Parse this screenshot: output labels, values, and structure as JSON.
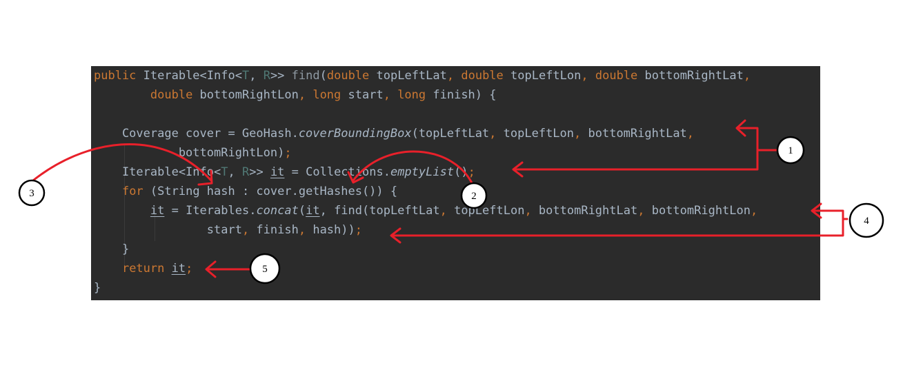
{
  "code": {
    "lines": [
      {
        "segments": [
          {
            "t": "public ",
            "c": "kw"
          },
          {
            "t": "Iterable<Info<"
          },
          {
            "t": "T",
            "c": "tp"
          },
          {
            "t": ", "
          },
          {
            "t": "R",
            "c": "tp"
          },
          {
            "t": ">> "
          },
          {
            "t": "find",
            "c": "dim"
          },
          {
            "t": "("
          },
          {
            "t": "double ",
            "c": "kw"
          },
          {
            "t": "topLeftLat"
          },
          {
            "t": ", ",
            "c": "kw"
          },
          {
            "t": "double ",
            "c": "kw"
          },
          {
            "t": "topLeftLon"
          },
          {
            "t": ", ",
            "c": "kw"
          },
          {
            "t": "double ",
            "c": "kw"
          },
          {
            "t": "bottomRightLat"
          },
          {
            "t": ",",
            "c": "kw"
          }
        ]
      },
      {
        "segments": [
          {
            "t": "        "
          },
          {
            "t": "double ",
            "c": "kw"
          },
          {
            "t": "bottomRightLon"
          },
          {
            "t": ", ",
            "c": "kw"
          },
          {
            "t": "long ",
            "c": "kw"
          },
          {
            "t": "start"
          },
          {
            "t": ", ",
            "c": "kw"
          },
          {
            "t": "long ",
            "c": "kw"
          },
          {
            "t": "finish) {"
          }
        ]
      },
      {
        "segments": [
          {
            "t": ""
          }
        ]
      },
      {
        "segments": [
          {
            "t": "    Coverage cover = GeoHash."
          },
          {
            "t": "coverBoundingBox",
            "c": "it"
          },
          {
            "t": "(topLeftLat"
          },
          {
            "t": ", ",
            "c": "kw"
          },
          {
            "t": "topLeftLon"
          },
          {
            "t": ", ",
            "c": "kw"
          },
          {
            "t": "bottomRightLat"
          },
          {
            "t": ",",
            "c": "kw"
          }
        ]
      },
      {
        "segments": [
          {
            "t": "            bottomRightLon)"
          },
          {
            "t": ";",
            "c": "kw"
          }
        ]
      },
      {
        "segments": [
          {
            "t": "    Iterable<Info<"
          },
          {
            "t": "T",
            "c": "tp"
          },
          {
            "t": ", "
          },
          {
            "t": "R",
            "c": "tp"
          },
          {
            "t": ">> "
          },
          {
            "t": "it",
            "c": "ul"
          },
          {
            "t": " = Collections."
          },
          {
            "t": "emptyList",
            "c": "it"
          },
          {
            "t": "()"
          },
          {
            "t": ";",
            "c": "kw"
          }
        ]
      },
      {
        "segments": [
          {
            "t": "    "
          },
          {
            "t": "for ",
            "c": "kw"
          },
          {
            "t": "(String hash : cover.getHashes()) {"
          }
        ]
      },
      {
        "segments": [
          {
            "t": "        "
          },
          {
            "t": "it",
            "c": "ul"
          },
          {
            "t": " = Iterables."
          },
          {
            "t": "concat",
            "c": "it"
          },
          {
            "t": "("
          },
          {
            "t": "it",
            "c": "ul"
          },
          {
            "t": ", find(topLeftLat"
          },
          {
            "t": ", ",
            "c": "kw"
          },
          {
            "t": "topLeftLon"
          },
          {
            "t": ", ",
            "c": "kw"
          },
          {
            "t": "bottomRightLat"
          },
          {
            "t": ", ",
            "c": "kw"
          },
          {
            "t": "bottomRightLon"
          },
          {
            "t": ",",
            "c": "kw"
          }
        ]
      },
      {
        "segments": [
          {
            "t": "                start"
          },
          {
            "t": ", ",
            "c": "kw"
          },
          {
            "t": "finish"
          },
          {
            "t": ", ",
            "c": "kw"
          },
          {
            "t": "hash))"
          },
          {
            "t": ";",
            "c": "kw"
          }
        ]
      },
      {
        "segments": [
          {
            "t": "    }"
          }
        ]
      },
      {
        "segments": [
          {
            "t": "    "
          },
          {
            "t": "return ",
            "c": "kw"
          },
          {
            "t": "it",
            "c": "ul"
          },
          {
            "t": ";",
            "c": "kw"
          }
        ]
      },
      {
        "segments": [
          {
            "t": "}"
          }
        ]
      }
    ]
  },
  "callouts": [
    {
      "label": "1"
    },
    {
      "label": "2"
    },
    {
      "label": "3"
    },
    {
      "label": "4"
    },
    {
      "label": "5"
    }
  ],
  "colors": {
    "background": "#2b2b2b",
    "text": "#a9b7c6",
    "keyword": "#cc7832",
    "type_param": "#507874",
    "arrow": "#e8202a"
  }
}
